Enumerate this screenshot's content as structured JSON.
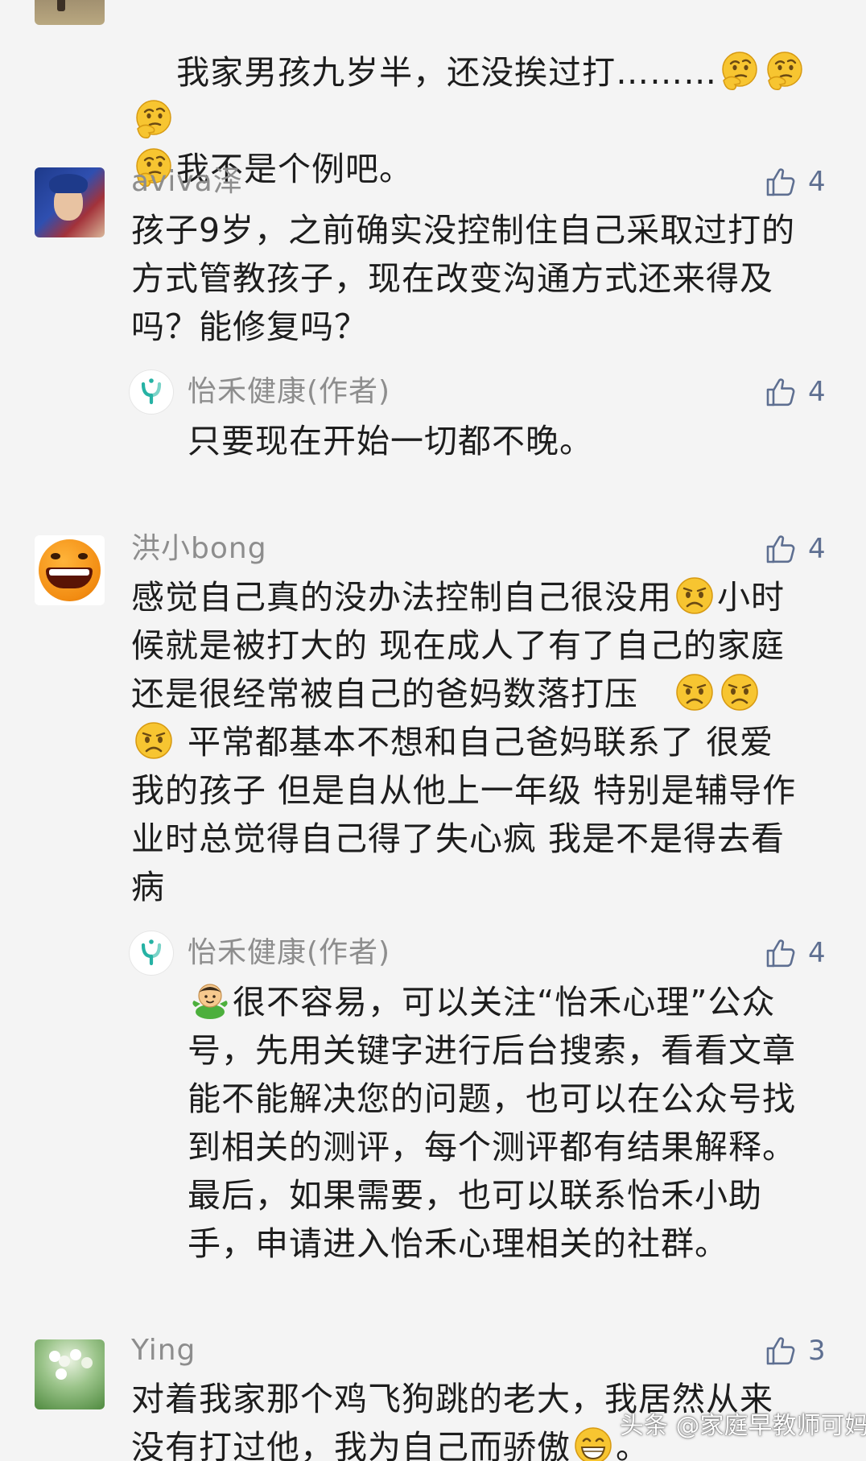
{
  "comments": [
    {
      "username": "",
      "text_line1": "我家男孩九岁半，还没挨过打………",
      "text_line2": "我不是个例吧。",
      "like_count": ""
    },
    {
      "username": "aviva泽",
      "text": "孩子9岁，之前确实没控制住自己采取过打的\n方式管教孩子，现在改变沟通方式还来得及\n吗？能修复吗？",
      "like_count": "4",
      "reply": {
        "username": "怡禾健康(作者)",
        "text": "只要现在开始一切都不晚。",
        "like_count": "4"
      }
    },
    {
      "username": "洪小bong",
      "text_a": "感觉自己真的没办法控制自己很没用",
      "text_b": "小时\n候就是被打大的 现在成人了有了自己的家庭\n还是很经常被自己的爸妈数落打压   ",
      "text_c": " 平常都基本不想和自己爸妈联系了 很爱\n我的孩子 但是自从他上一年级 特别是辅导作\n业时总觉得自己得了失心疯 我是不是得去看\n病",
      "like_count": "4",
      "reply": {
        "username": "怡禾健康(作者)",
        "text": "很不容易，可以关注“怡禾心理”公众\n号，先用关键字进行后台搜索，看看文章\n能不能解决您的问题，也可以在公众号找\n到相关的测评，每个测评都有结果解释。\n最后，如果需要，也可以联系怡禾小助\n手，申请进入怡禾心理相关的社群。",
        "like_count": "4"
      }
    },
    {
      "username": "Ying",
      "text_a": "对着我家那个鸡飞狗跳的老大，我居然从来\n没有打过他，我为自己而骄傲",
      "text_b": "。",
      "like_count": "3"
    }
  ],
  "icons": {
    "like": "thumbs-up-icon",
    "thinking_emoji": "thinking-face-emoji",
    "sad_emoji": "frowning-face-emoji",
    "grin_emoji": "grinning-face-emoji",
    "doll_emoji": "green-doll-emoji",
    "author_logo": "yihe-health-logo"
  },
  "colors": {
    "background": "#f4f4f4",
    "username": "#8d8d8d",
    "text": "#1d1d1d",
    "like": "#5e6f91",
    "author_logo": "#26b2a4"
  },
  "watermark": "头条 @家庭早教师可妈"
}
